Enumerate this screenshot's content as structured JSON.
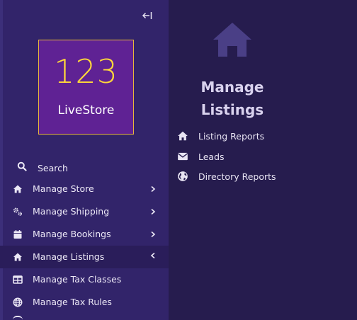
{
  "sidebar": {
    "logo": {
      "number": "123",
      "text": "LiveStore"
    },
    "search_label": "Search",
    "items": [
      {
        "label": "Manage Store",
        "icon": "home-icon",
        "chevron": "chevron-right-icon"
      },
      {
        "label": "Manage Shipping",
        "icon": "gears-icon",
        "chevron": "chevron-right-icon"
      },
      {
        "label": "Manage Bookings",
        "icon": "calendar-icon",
        "chevron": "chevron-right-icon"
      },
      {
        "label": "Manage Listings",
        "icon": "home-icon",
        "chevron": "chevron-left-icon",
        "active": true
      },
      {
        "label": "Manage Tax Classes",
        "icon": "table-icon"
      },
      {
        "label": "Manage Tax Rules",
        "icon": "globe-icon"
      }
    ]
  },
  "main": {
    "title_line1": "Manage",
    "title_line2": "Listings",
    "items": [
      {
        "label": "Listing Reports",
        "icon": "home-icon"
      },
      {
        "label": "Leads",
        "icon": "envelope-icon"
      },
      {
        "label": "Directory Reports",
        "icon": "globe-icon"
      }
    ]
  },
  "colors": {
    "sidebar_bg": "#32246a",
    "main_bg": "#261c4e",
    "logo_bg": "#5f2294",
    "logo_accent": "#ffd83a"
  }
}
